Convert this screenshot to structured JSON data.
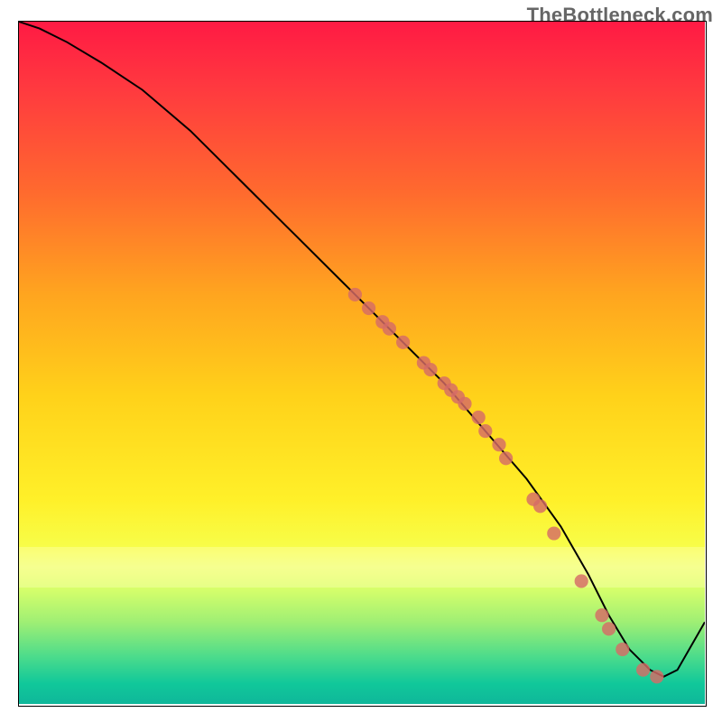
{
  "watermark": "TheBottleneck.com",
  "chart_data": {
    "type": "line",
    "title": "",
    "xlabel": "",
    "ylabel": "",
    "xlim": [
      0,
      100
    ],
    "ylim": [
      0,
      100
    ],
    "grid": false,
    "legend": false,
    "series": [
      {
        "name": "bottleneck-curve",
        "x": [
          0,
          3,
          7,
          12,
          18,
          25,
          32,
          40,
          48,
          55,
          62,
          68,
          74,
          79,
          83,
          86,
          89,
          92,
          94,
          96,
          100
        ],
        "y": [
          100,
          99,
          97,
          94,
          90,
          84,
          77,
          69,
          61,
          54,
          47,
          40,
          33,
          26,
          19,
          13,
          8,
          5,
          4,
          5,
          12
        ],
        "color": "#000000"
      }
    ],
    "markers": {
      "name": "highlighted-points",
      "color": "#d56b66",
      "points": [
        {
          "x": 49,
          "y": 60
        },
        {
          "x": 51,
          "y": 58
        },
        {
          "x": 53,
          "y": 56
        },
        {
          "x": 54,
          "y": 55
        },
        {
          "x": 56,
          "y": 53
        },
        {
          "x": 59,
          "y": 50
        },
        {
          "x": 60,
          "y": 49
        },
        {
          "x": 62,
          "y": 47
        },
        {
          "x": 63,
          "y": 46
        },
        {
          "x": 64,
          "y": 45
        },
        {
          "x": 65,
          "y": 44
        },
        {
          "x": 67,
          "y": 42
        },
        {
          "x": 68,
          "y": 40
        },
        {
          "x": 70,
          "y": 38
        },
        {
          "x": 71,
          "y": 36
        },
        {
          "x": 75,
          "y": 30
        },
        {
          "x": 76,
          "y": 29
        },
        {
          "x": 78,
          "y": 25
        },
        {
          "x": 82,
          "y": 18
        },
        {
          "x": 85,
          "y": 13
        },
        {
          "x": 86,
          "y": 11
        },
        {
          "x": 88,
          "y": 8
        },
        {
          "x": 91,
          "y": 5
        },
        {
          "x": 93,
          "y": 4
        }
      ]
    }
  }
}
